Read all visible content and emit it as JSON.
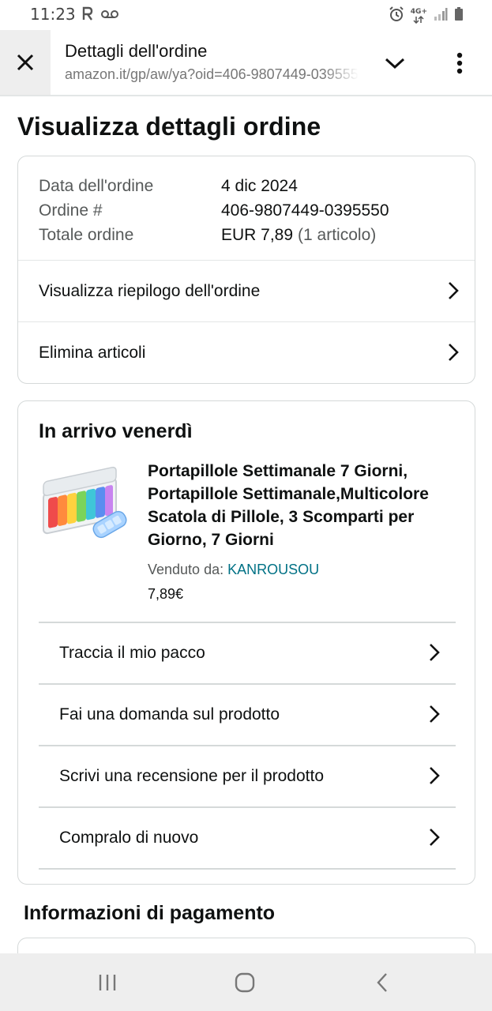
{
  "status_bar": {
    "time": "11:23",
    "network_type": "4G+",
    "icons": [
      "r-icon",
      "voicemail-icon",
      "alarm-icon",
      "network-icon",
      "signal-icon",
      "battery-icon"
    ]
  },
  "browser": {
    "title": "Dettagli dell'ordine",
    "url": "amazon.it/gp/aw/ya?oid=406-9807449-0395550",
    "icons": [
      "close-icon",
      "chevron-down-icon",
      "more-vert-icon"
    ]
  },
  "page": {
    "title": "Visualizza dettagli ordine"
  },
  "order_summary": {
    "rows": [
      {
        "label": "Data dell'ordine",
        "value": "4 dic 2024",
        "extra": ""
      },
      {
        "label": "Ordine #",
        "value": "406-9807449-0395550",
        "extra": ""
      },
      {
        "label": "Totale ordine",
        "value": "EUR 7,89",
        "extra": "(1 articolo)"
      }
    ],
    "links": [
      {
        "label": "Visualizza riepilogo dell'ordine"
      },
      {
        "label": "Elimina articoli"
      }
    ]
  },
  "delivery": {
    "heading": "In arrivo venerdì",
    "product": {
      "title": "Portapillole Settimanale 7 Giorni, Portapillole Settimanale,Multicolore Scatola di Pillole, 3 Scomparti per Giorno, 7 Giorni",
      "seller_label": "Venduto da:",
      "seller_name": "KANROUSOU",
      "price": "7,89€",
      "image_icon": "pill-organizer-image"
    },
    "actions": [
      {
        "label": "Traccia il mio pacco"
      },
      {
        "label": "Fai una domanda sul prodotto"
      },
      {
        "label": "Scrivi una recensione per il prodotto"
      },
      {
        "label": "Compralo di nuovo"
      }
    ]
  },
  "payment": {
    "title": "Informazioni di pagamento"
  },
  "nav_bar": {
    "icons": [
      "recents-icon",
      "home-icon",
      "back-icon"
    ]
  },
  "colors": {
    "link": "#007185",
    "text": "#0f1111",
    "muted": "#565959",
    "border": "#d5d9d9"
  }
}
